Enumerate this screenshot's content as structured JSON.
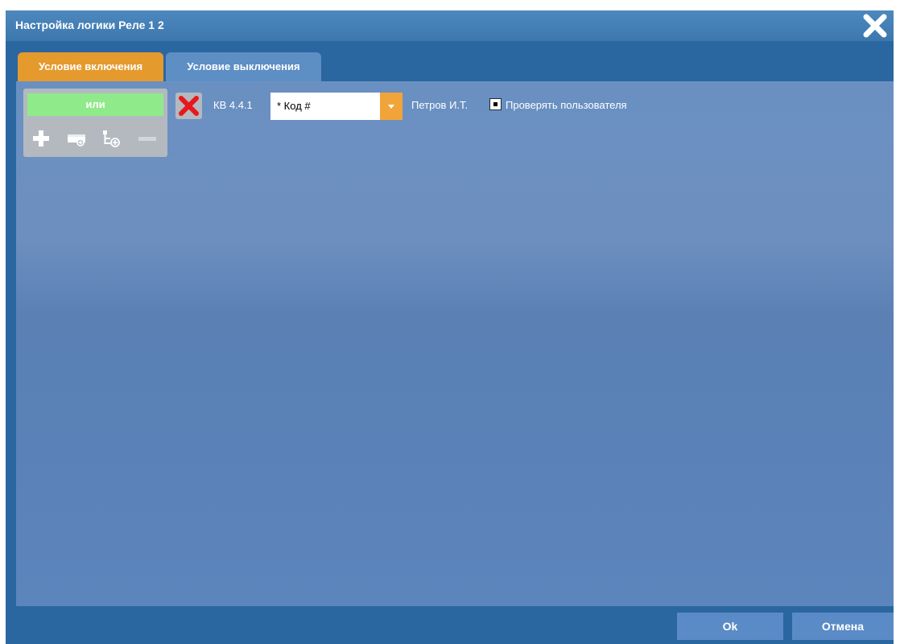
{
  "dialog": {
    "title": "Настройка логики Реле 1 2",
    "close_icon": "close-icon"
  },
  "tabs": [
    {
      "label": "Условие включения",
      "active": true
    },
    {
      "label": "Условие выключения",
      "active": false
    }
  ],
  "logic_block": {
    "operator": "или",
    "tools": [
      "plus-icon",
      "add-group-icon",
      "add-branch-icon",
      "minus-icon"
    ]
  },
  "condition": {
    "delete_icon": "delete-x-icon",
    "label": "КВ 4.4.1",
    "select_value": "* Код #",
    "user": "Петров И.Т.",
    "check_user_label": "Проверять пользователя",
    "check_user_checked": true
  },
  "buttons": {
    "ok": "Ok",
    "cancel": "Отмена"
  },
  "colors": {
    "active_tab": "#e59a2e",
    "inactive_tab": "#5d8ec4",
    "or_block": "#8fea8a",
    "delete_x": "#e8171c"
  }
}
